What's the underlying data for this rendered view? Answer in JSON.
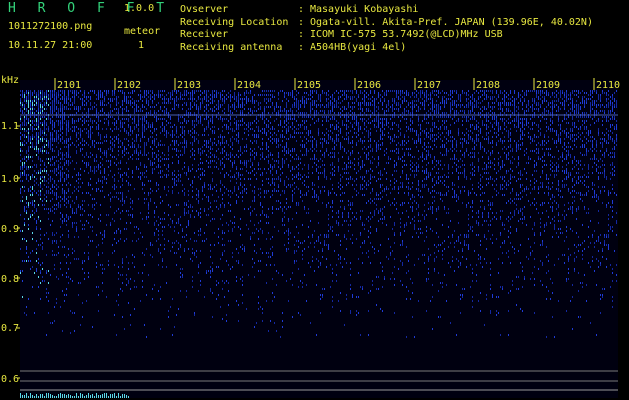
{
  "app": {
    "title": "H R O F F T",
    "version": "1.0.0"
  },
  "file": {
    "name": "1011272100.png",
    "mode": "meteor",
    "datetime": "10.11.27 21:00",
    "count": "1"
  },
  "meta": [
    {
      "key": "Ovserver",
      "value": "Masayuki Kobayashi"
    },
    {
      "key": "Receiving Location",
      "value": "Ogata-vill. Akita-Pref. JAPAN (139.96E, 40.02N)"
    },
    {
      "key": "Receiver",
      "value": "ICOM IC-575 53.7492(@LCD)MHz USB"
    },
    {
      "key": "Receiving antenna",
      "value": "A504HB(yagi 4el)"
    }
  ],
  "axes": {
    "y_unit": "kHz",
    "y_ticks": [
      "1.1",
      "1.0",
      "0.9",
      "0.8",
      "0.7",
      "0.6"
    ],
    "x_ticks": [
      "2101",
      "2102",
      "2103",
      "2104",
      "2105",
      "2106",
      "2107",
      "2108",
      "2109",
      "2110"
    ]
  },
  "colors": {
    "label": "#e8e840",
    "title": "#33d27a",
    "noise": "#1f3bd6",
    "hot": "#5bd6e8"
  }
}
